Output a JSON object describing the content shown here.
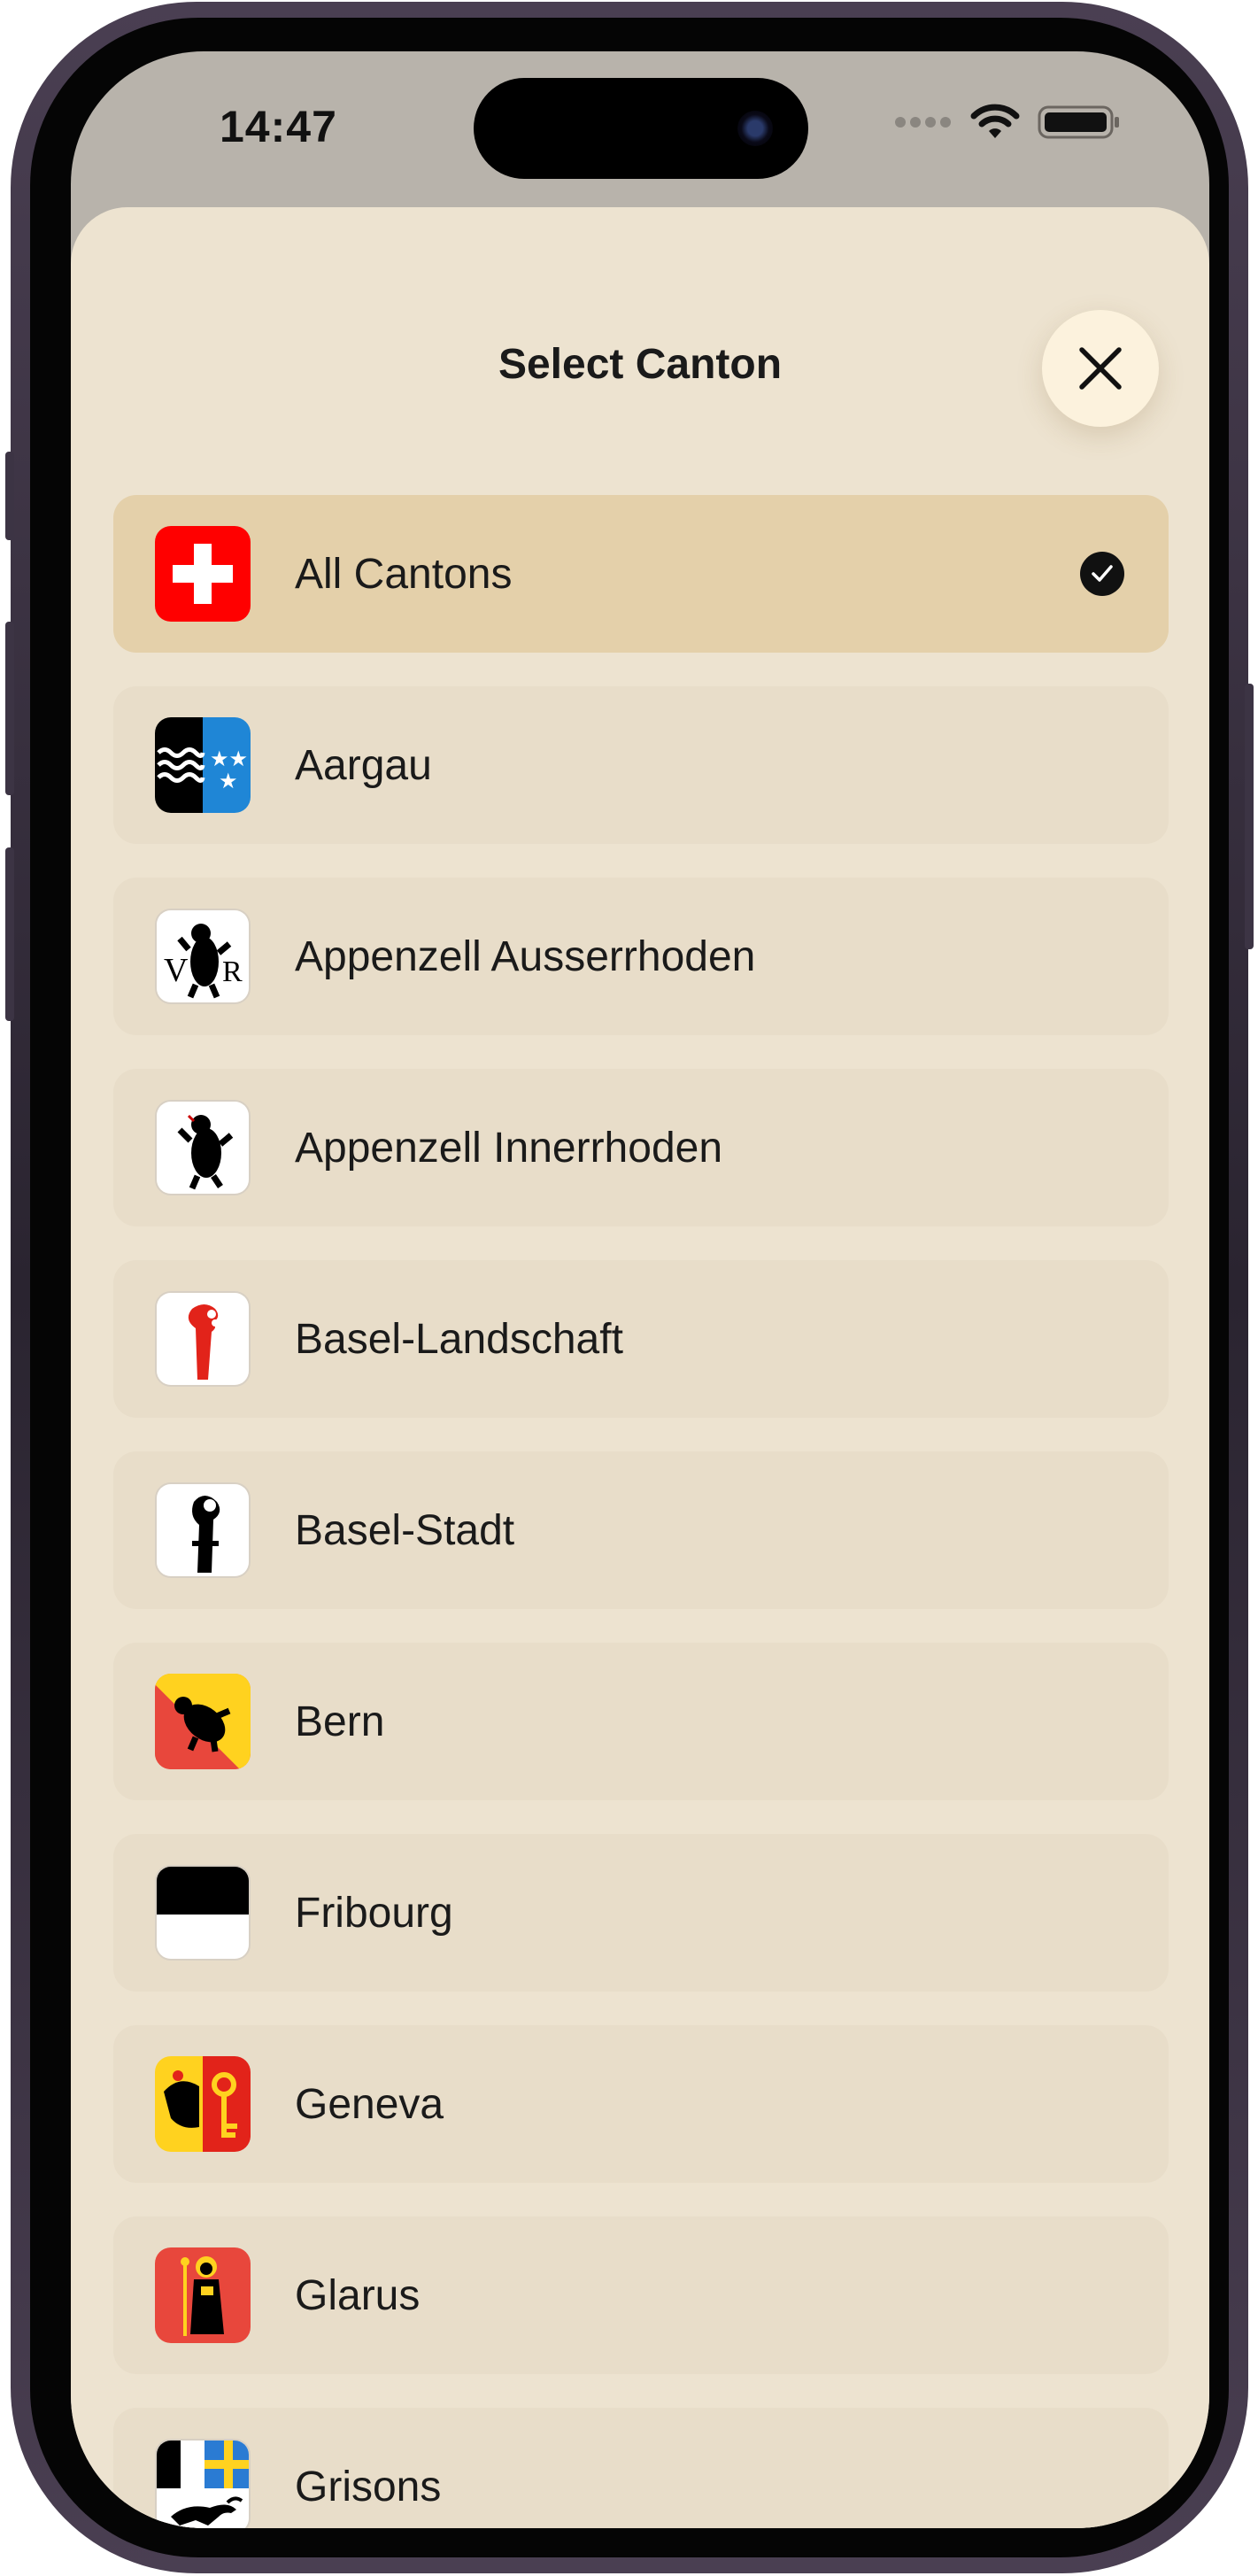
{
  "status_bar": {
    "time": "14:47"
  },
  "sheet": {
    "title": "Select Canton",
    "close_icon": "close-icon"
  },
  "cantons": [
    {
      "label": "All Cantons",
      "flag": "switzerland-flag",
      "selected": true
    },
    {
      "label": "Aargau",
      "flag": "aargau-flag",
      "selected": false
    },
    {
      "label": "Appenzell Ausserrhoden",
      "flag": "appenzell-ausserrhoden-flag",
      "selected": false
    },
    {
      "label": "Appenzell Innerrhoden",
      "flag": "appenzell-innerrhoden-flag",
      "selected": false
    },
    {
      "label": "Basel-Landschaft",
      "flag": "basel-landschaft-flag",
      "selected": false
    },
    {
      "label": "Basel-Stadt",
      "flag": "basel-stadt-flag",
      "selected": false
    },
    {
      "label": "Bern",
      "flag": "bern-flag",
      "selected": false
    },
    {
      "label": "Fribourg",
      "flag": "fribourg-flag",
      "selected": false
    },
    {
      "label": "Geneva",
      "flag": "geneva-flag",
      "selected": false
    },
    {
      "label": "Glarus",
      "flag": "glarus-flag",
      "selected": false
    },
    {
      "label": "Grisons",
      "flag": "grisons-flag",
      "selected": false
    }
  ],
  "colors": {
    "sheet_background": "#ede3d0",
    "row_background": "#e8ddc9",
    "selected_row_background": "#e4d0aa",
    "close_button_background": "#fcf2dd"
  }
}
